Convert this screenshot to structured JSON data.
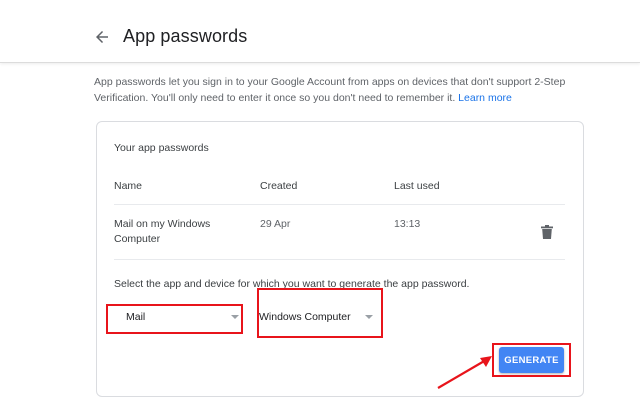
{
  "header": {
    "title": "App passwords",
    "back_icon": "arrow-left-icon"
  },
  "intro": {
    "text": "App passwords let you sign in to your Google Account from apps on devices that don't support 2-Step Verification. You'll only need to enter it once so you don't need to remember it.",
    "link": "Learn more"
  },
  "card": {
    "title": "Your app passwords",
    "columns": [
      "Name",
      "Created",
      "Last used"
    ],
    "rows": [
      {
        "name": "Mail on my Windows Computer",
        "created": "29 Apr",
        "last_used": "13:13",
        "delete_icon": "trash-icon"
      }
    ],
    "select_prompt": "Select the app and device for which you want to generate the app password.",
    "app_select": {
      "value": "Mail"
    },
    "device_select": {
      "value": "Windows Computer"
    },
    "generate_label": "GENERATE"
  },
  "annotations": {
    "highlight_color": "#e8141b",
    "arrow_icon": "red-arrow-icon"
  },
  "colors": {
    "accent": "#4285f4",
    "link": "#1a73e8"
  }
}
